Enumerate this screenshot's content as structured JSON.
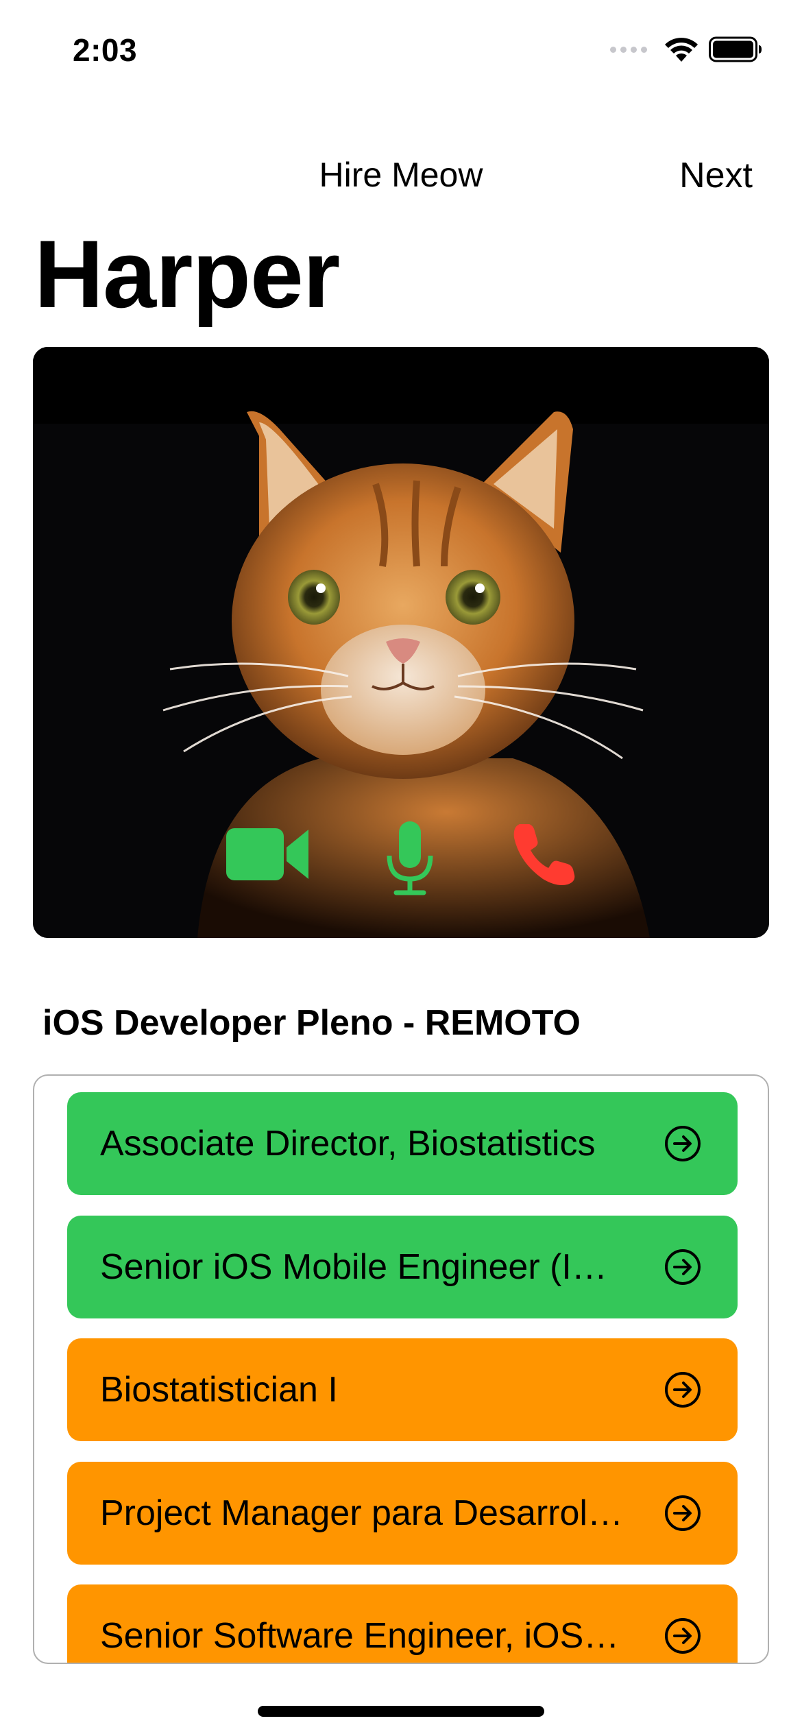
{
  "status_bar": {
    "time": "2:03"
  },
  "nav": {
    "title": "Hire Meow",
    "next_label": "Next"
  },
  "candidate": {
    "name": "Harper"
  },
  "colors": {
    "green": "#34c759",
    "orange": "#ff9500",
    "red": "#ff3b30",
    "border": "#b0b0b0"
  },
  "call_controls": {
    "camera_icon": "video-camera-icon",
    "mic_icon": "microphone-icon",
    "hangup_icon": "phone-hangup-icon"
  },
  "section": {
    "title": "iOS Developer Pleno - REMOTO"
  },
  "jobs": [
    {
      "label": "Associate Director, Biostatistics",
      "color": "green"
    },
    {
      "label": "Senior iOS Mobile Engineer (I…",
      "color": "green"
    },
    {
      "label": "Biostatistician I",
      "color": "orange"
    },
    {
      "label": "Project Manager para Desarrol…",
      "color": "orange"
    },
    {
      "label": "Senior Software Engineer, iOS…",
      "color": "orange"
    }
  ]
}
